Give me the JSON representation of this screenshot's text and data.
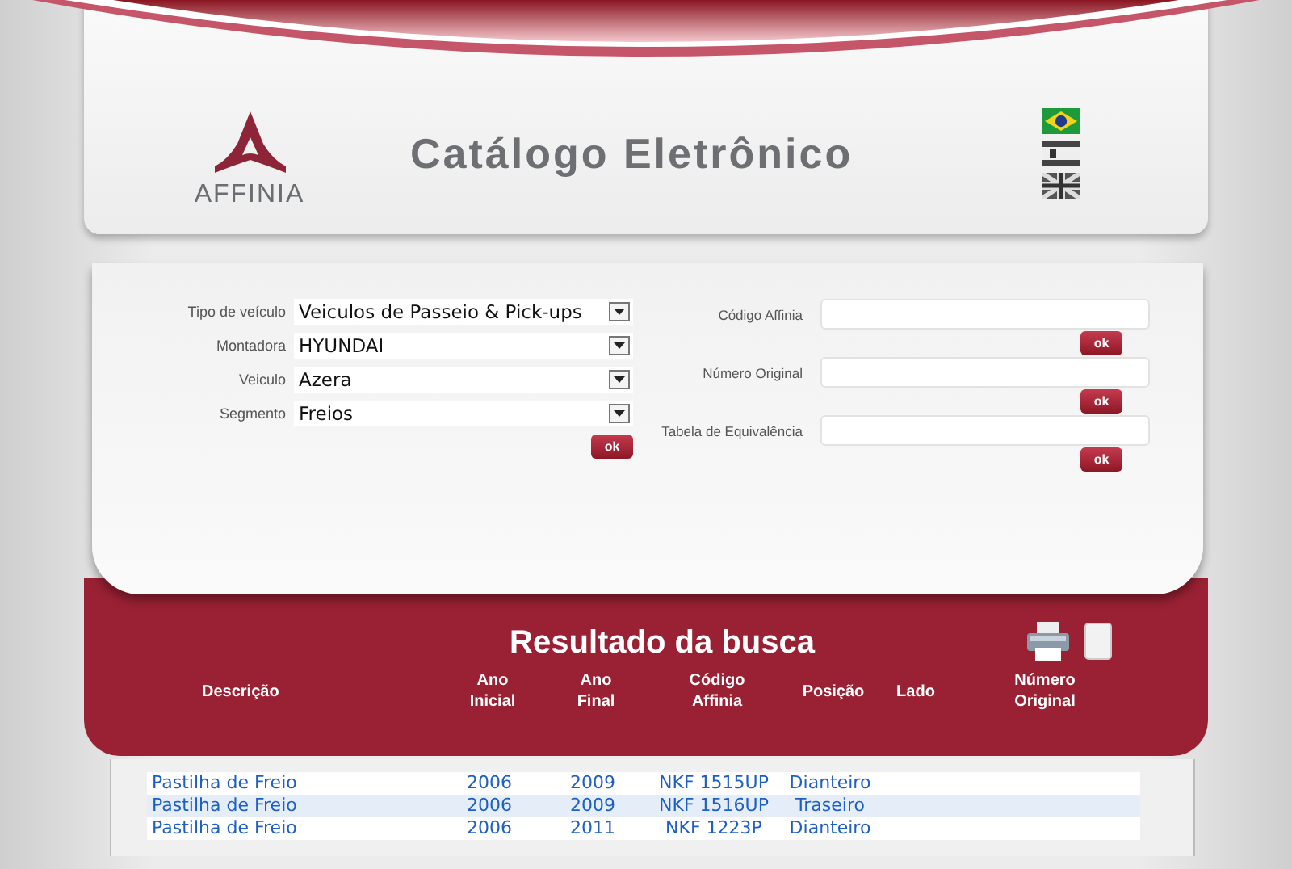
{
  "header": {
    "logo_text": "AFFINIA",
    "title": "Catálogo Eletrônico"
  },
  "vehicle_search": {
    "fields": [
      {
        "label": "Tipo de veículo",
        "value": "Veiculos de Passeio & Pick-ups"
      },
      {
        "label": "Montadora",
        "value": "HYUNDAI"
      },
      {
        "label": "Veiculo",
        "value": "Azera"
      },
      {
        "label": "Segmento",
        "value": "Freios"
      }
    ],
    "button": "ok"
  },
  "code_search": [
    {
      "label": "Código Affinia",
      "button": "ok"
    },
    {
      "label": "Número Original",
      "button": "ok"
    },
    {
      "label": "Tabela de Equivalência",
      "button": "ok"
    }
  ],
  "results": {
    "title": "Resultado da busca",
    "columns": [
      "Descrição",
      "Ano Inicial",
      "Ano Final",
      "Código Affinia",
      "Posição",
      "Lado",
      "Número Original"
    ],
    "rows": [
      {
        "description": "Pastilha de Freio",
        "year_start": "2006",
        "year_end": "2009",
        "code": "NKF 1515UP",
        "position": "Dianteiro"
      },
      {
        "description": "Pastilha de Freio",
        "year_start": "2006",
        "year_end": "2009",
        "code": "NKF 1516UP",
        "position": "Traseiro"
      },
      {
        "description": "Pastilha de Freio",
        "year_start": "2006",
        "year_end": "2011",
        "code": "NKF 1223P",
        "position": "Dianteiro"
      }
    ]
  }
}
